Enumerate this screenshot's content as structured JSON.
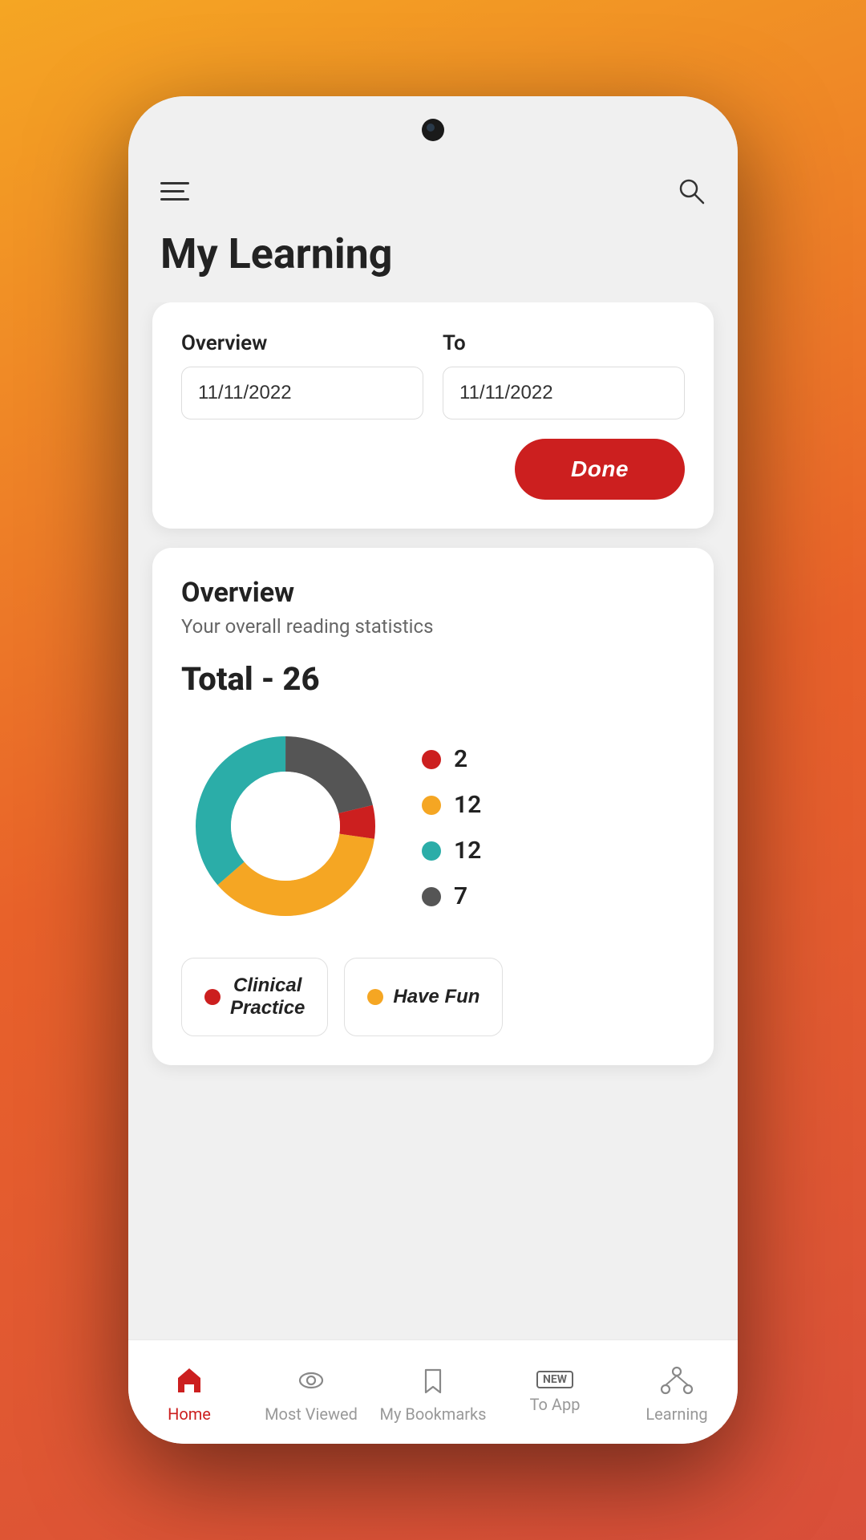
{
  "background": {
    "gradient_start": "#F5A623",
    "gradient_end": "#D94F3A"
  },
  "header": {
    "title": "My Learning",
    "menu_aria": "Open menu",
    "search_aria": "Search"
  },
  "date_filter": {
    "from_label": "Overview",
    "to_label": "To",
    "from_value": "11/11/2022",
    "to_value": "11/11/2022",
    "done_label": "Done"
  },
  "overview": {
    "title": "Overview",
    "subtitle": "Your overall reading statistics",
    "total_label": "Total - 26",
    "chart": {
      "segments": [
        {
          "color": "#cc1f1f",
          "value": 2,
          "percent": 7.7
        },
        {
          "color": "#F5A623",
          "value": 12,
          "percent": 46.2
        },
        {
          "color": "#2BADA8",
          "value": 12,
          "percent": 46.2
        },
        {
          "color": "#555555",
          "value": 7,
          "percent": 26.9
        }
      ],
      "legend": [
        {
          "color": "#cc1f1f",
          "value": "2"
        },
        {
          "color": "#F5A623",
          "value": "12"
        },
        {
          "color": "#2BADA8",
          "value": "12"
        },
        {
          "color": "#555555",
          "value": "7"
        }
      ]
    },
    "categories": [
      {
        "label": "Clinical\nPractice",
        "color": "#cc1f1f"
      },
      {
        "label": "Have Fun",
        "color": "#F5A623"
      }
    ]
  },
  "bottom_nav": {
    "items": [
      {
        "id": "home",
        "label": "Home",
        "active": true
      },
      {
        "id": "most-viewed",
        "label": "Most Viewed",
        "active": false
      },
      {
        "id": "my-bookmarks",
        "label": "My Bookmarks",
        "active": false
      },
      {
        "id": "new-to-app",
        "label": "To App",
        "badge": "NEW",
        "active": false
      },
      {
        "id": "learning",
        "label": "Learning",
        "active": false
      }
    ]
  }
}
